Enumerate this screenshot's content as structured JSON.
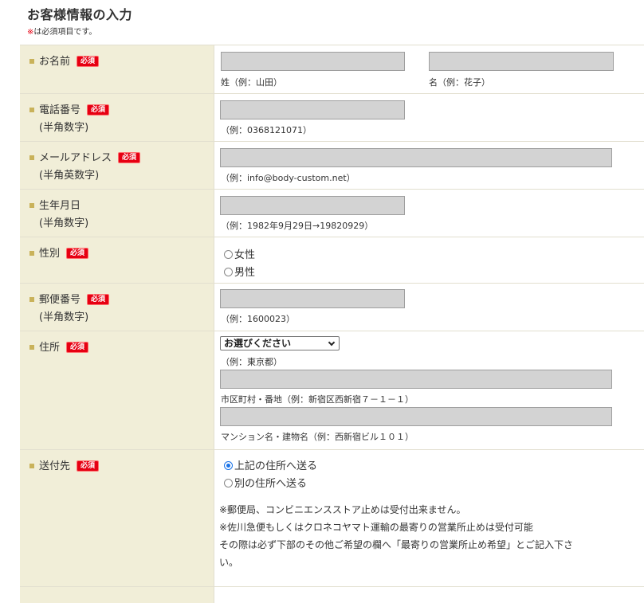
{
  "page": {
    "title": "お客様情報の入力",
    "required_mark": "※",
    "required_text": "は必須項目です。"
  },
  "badge": "必須",
  "rows": {
    "name": {
      "label": "お名前",
      "last_hint": "姓（例：山田）",
      "first_hint": "名（例：花子）",
      "last_value": "",
      "first_value": ""
    },
    "phone": {
      "label": "電話番号",
      "sub": "(半角数字)",
      "hint": "（例：0368121071）",
      "value": ""
    },
    "email": {
      "label": "メールアドレス",
      "sub": "(半角英数字)",
      "hint": "（例：info@body-custom.net）",
      "value": ""
    },
    "birthday": {
      "label": "生年月日",
      "sub": "(半角数字)",
      "hint": "（例：1982年9月29日→19820929）",
      "value": ""
    },
    "gender": {
      "label": "性別",
      "options": [
        "女性",
        "男性"
      ]
    },
    "postal": {
      "label": "郵便番号",
      "sub": "(半角数字)",
      "hint": "（例：1600023）",
      "value": ""
    },
    "address": {
      "label": "住所",
      "select_value": "お選びください",
      "select_hint": "（例：東京都）",
      "street_hint": "市区町村・番地（例：新宿区西新宿７－１－１）",
      "building_hint": "マンション名・建物名（例：西新宿ビル１０１）"
    },
    "shipping": {
      "label": "送付先",
      "options": [
        "上記の住所へ送る",
        "別の住所へ送る"
      ],
      "selected": "上記の住所へ送る",
      "notes": [
        "※郵便局、コンビニエンスストア止めは受付出来ません。",
        "※佐川急便もしくはクロネコヤマト運輸の最寄りの営業所止めは受付可能",
        "その際は必ず下部のその他ご希望の欄へ「最寄りの営業所止め希望」とご記入下さ",
        "い。"
      ]
    }
  }
}
